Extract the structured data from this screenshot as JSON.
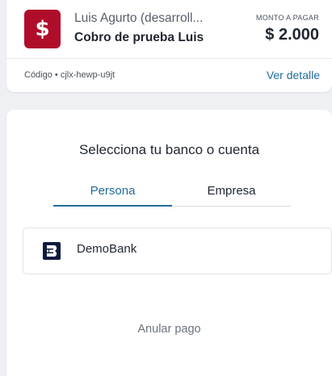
{
  "header": {
    "merchant_logo_glyph": "$",
    "merchant_logo_color": "#b00d2b",
    "merchant_name": "Luis Agurto (desarroll...",
    "payment_description": "Cobro de prueba Luis",
    "amount_label": "MONTO A PAGAR",
    "amount_value": "$ 2.000",
    "code_text": "Código • cjlx-hewp-u9jt",
    "details_link": "Ver detalle"
  },
  "bank_selection": {
    "title": "Selecciona tu banco o cuenta",
    "tabs": [
      {
        "label": "Persona",
        "active": true
      },
      {
        "label": "Empresa",
        "active": false
      }
    ],
    "banks": [
      {
        "name": "DemoBank",
        "icon": "demobank-logo-icon"
      }
    ],
    "cancel_label": "Anular pago"
  },
  "colors": {
    "accent": "#1f6c9a",
    "background": "#eef0f3"
  }
}
